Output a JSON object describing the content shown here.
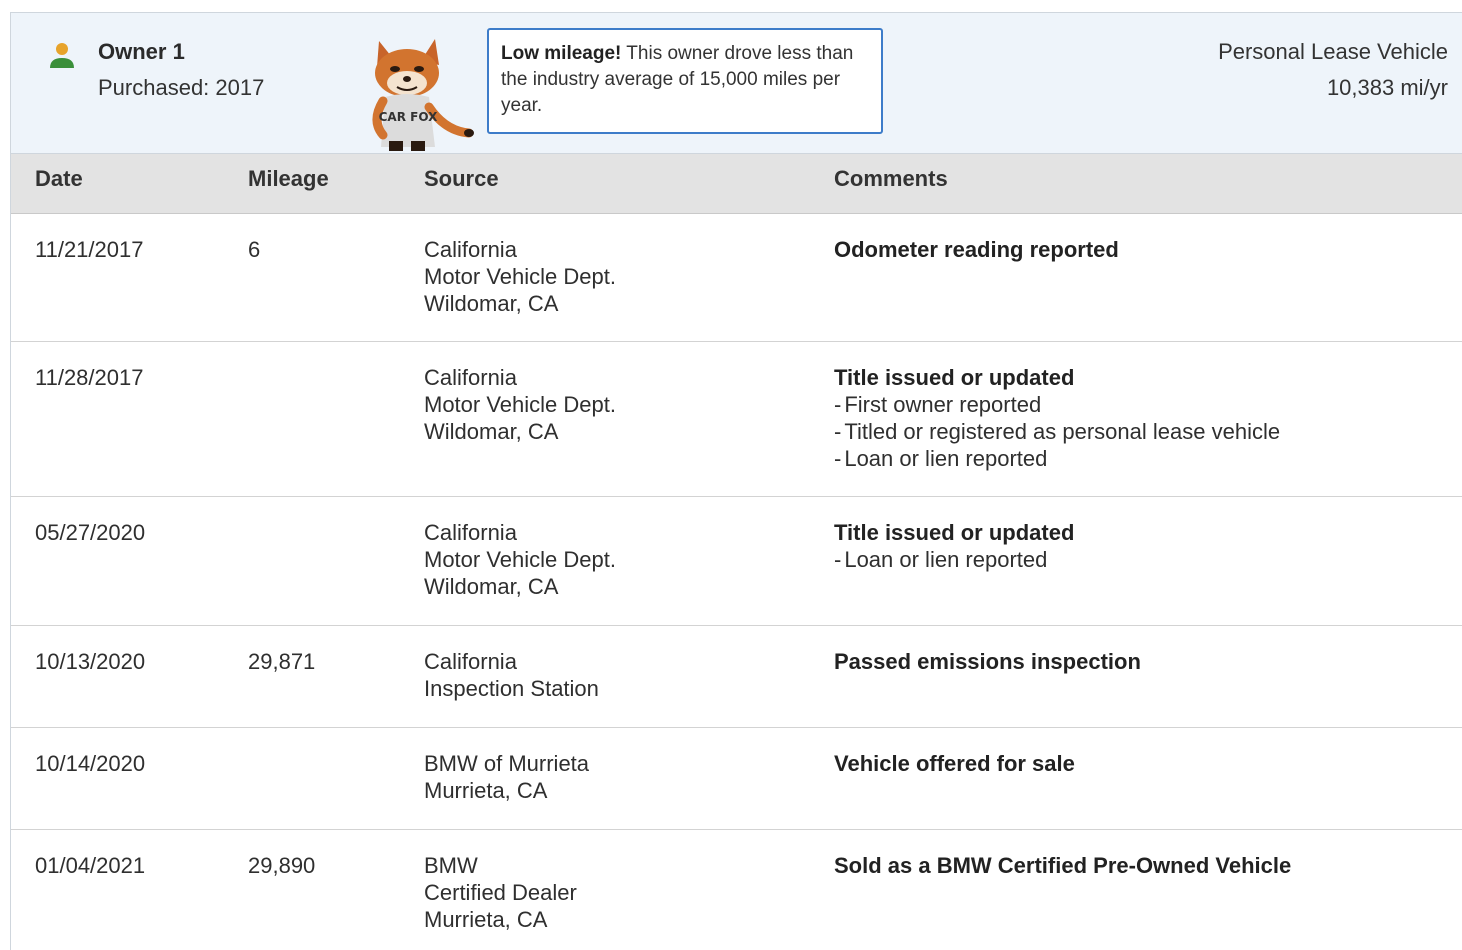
{
  "owner": {
    "name": "Owner 1",
    "purchased": "Purchased: 2017",
    "callout_bold": "Low mileage!",
    "callout_text": " This owner drove less than the industry average of 15,000 miles per year.",
    "vehicle_type": "Personal Lease Vehicle",
    "miles_per_year": "10,383 mi/yr",
    "fox_shirt": "CAR FOX",
    "icon": "person-icon"
  },
  "columns": {
    "date": "Date",
    "mileage": "Mileage",
    "source": "Source",
    "comments": "Comments"
  },
  "rows": [
    {
      "date": "11/21/2017",
      "mileage": "6",
      "source": [
        "California",
        "Motor Vehicle Dept.",
        "Wildomar, CA"
      ],
      "title": "Odometer reading reported",
      "items": []
    },
    {
      "date": "11/28/2017",
      "mileage": "",
      "source": [
        "California",
        "Motor Vehicle Dept.",
        "Wildomar, CA"
      ],
      "title": "Title issued or updated",
      "items": [
        "First owner reported",
        "Titled or registered as personal lease vehicle",
        "Loan or lien reported"
      ]
    },
    {
      "date": "05/27/2020",
      "mileage": "",
      "source": [
        "California",
        "Motor Vehicle Dept.",
        "Wildomar, CA"
      ],
      "title": "Title issued or updated",
      "items": [
        "Loan or lien reported"
      ]
    },
    {
      "date": "10/13/2020",
      "mileage": "29,871",
      "source": [
        "California",
        "Inspection Station"
      ],
      "title": "Passed emissions inspection",
      "items": []
    },
    {
      "date": "10/14/2020",
      "mileage": "",
      "source": [
        "BMW of Murrieta",
        "Murrieta, CA"
      ],
      "title": "Vehicle offered for sale",
      "items": []
    },
    {
      "date": "01/04/2021",
      "mileage": "29,890",
      "source": [
        "BMW",
        "Certified Dealer",
        "Murrieta, CA"
      ],
      "title": "Sold as a BMW Certified Pre-Owned Vehicle",
      "items": []
    }
  ]
}
